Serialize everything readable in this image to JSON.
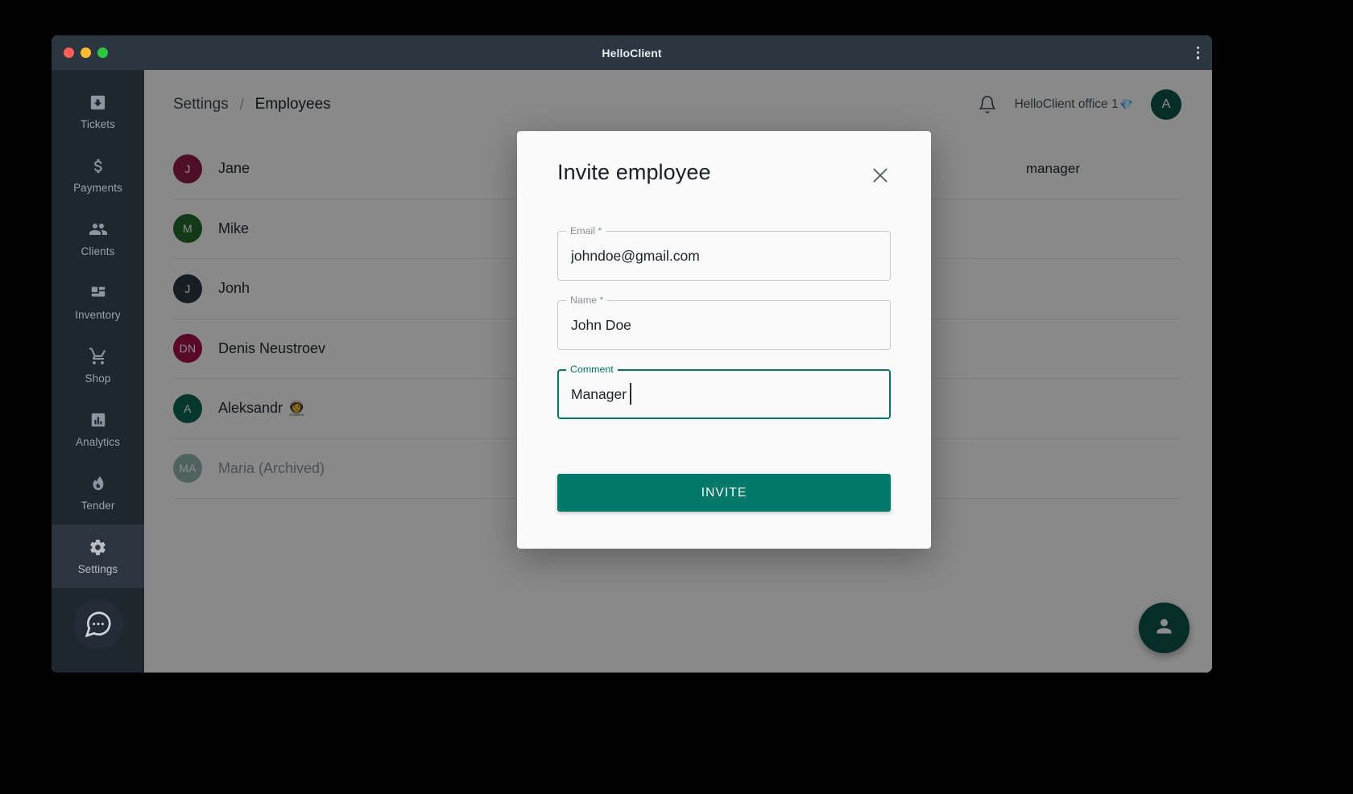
{
  "window": {
    "title": "HelloClient",
    "traffic_lights": [
      "close",
      "minimize",
      "zoom"
    ],
    "menu_icon": "kebab-menu-icon"
  },
  "sidebar": {
    "items": [
      {
        "label": "Tickets",
        "icon": "ticket-inbox-icon",
        "active": false
      },
      {
        "label": "Payments",
        "icon": "dollar-icon",
        "active": false
      },
      {
        "label": "Clients",
        "icon": "people-icon",
        "active": false
      },
      {
        "label": "Inventory",
        "icon": "grid-layout-icon",
        "active": false
      },
      {
        "label": "Shop",
        "icon": "shopping-cart-icon",
        "active": false
      },
      {
        "label": "Analytics",
        "icon": "bar-chart-icon",
        "active": false
      },
      {
        "label": "Tender",
        "icon": "flame-icon",
        "active": false
      },
      {
        "label": "Settings",
        "icon": "gear-icon",
        "active": true
      }
    ],
    "chat_button_icon": "chat-bubble-icon"
  },
  "topbar": {
    "breadcrumb": {
      "parent": "Settings",
      "separator": "/",
      "current": "Employees"
    },
    "bell_icon": "notification-bell-icon",
    "office": "HelloClient office 1",
    "office_badge": "💎",
    "avatar_initial": "A"
  },
  "employees": {
    "role_column_value": "manager",
    "rows": [
      {
        "initials": "J",
        "name": "Jane",
        "color": "#8e1b4a",
        "role": "manager",
        "archived": false
      },
      {
        "initials": "M",
        "name": "Mike",
        "color": "#246b2c",
        "role": "",
        "archived": false
      },
      {
        "initials": "J",
        "name": "Jonh",
        "color": "#2b3741",
        "role": "",
        "archived": false
      },
      {
        "initials": "DN",
        "name": "Denis Neustroev",
        "color": "#a3104a",
        "role": "",
        "archived": false
      },
      {
        "initials": "A",
        "name": "Aleksandr",
        "color": "#0d6655",
        "role": "",
        "archived": false,
        "emoji": "👩‍🚀"
      },
      {
        "initials": "MA",
        "name": "Maria (Archived)",
        "color": "#8fb3ac",
        "role": "",
        "archived": true
      }
    ]
  },
  "fab": {
    "icon": "person-add-icon",
    "color": "#0d5349"
  },
  "modal": {
    "title": "Invite employee",
    "close_icon": "close-icon",
    "fields": [
      {
        "label": "Email *",
        "value": "johndoe@gmail.com",
        "placeholder": "",
        "focused": false
      },
      {
        "label": "Name *",
        "value": "John Doe",
        "placeholder": "",
        "focused": false
      },
      {
        "label": "Comment",
        "value": "Manager ",
        "placeholder": "",
        "focused": true
      }
    ],
    "submit_label": "INVITE",
    "accent_color": "#00796b"
  }
}
